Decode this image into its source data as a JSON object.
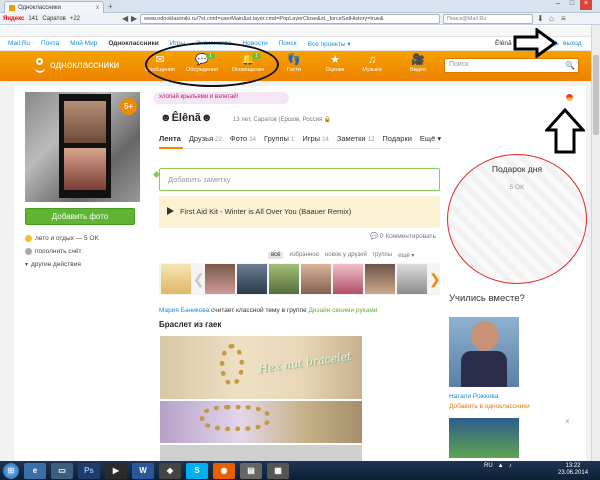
{
  "browser": {
    "tab_title": "Одноклассники",
    "tab_close": "x",
    "new_tab": "+",
    "window_buttons": [
      "–",
      "□",
      "×"
    ],
    "toolbar_items": [
      "Яндекс",
      "141",
      "Саратов",
      "+22"
    ],
    "url": "www.odnoklassniki.ru/?st.cmd=userMain&st.layer.cmd=PopLayerClose&st._forceSetHistory=true&",
    "search_placeholder": "Поиск@Mail.Ru"
  },
  "mailru_bar": {
    "items": [
      "Mail.Ru",
      "Почта",
      "Мой Мир",
      "Одноклассники",
      "Игры",
      "Знакомства",
      "Новости",
      "Поиск",
      "Все проекты ▾"
    ],
    "active": "Одноклассники",
    "user": "Êlênã",
    "help": "помощь",
    "exit": "выход"
  },
  "ok_toolbar": {
    "logo_text": "одноклассники",
    "nav": [
      {
        "label": "Сообщения",
        "icon": "envelope-icon",
        "badge": ""
      },
      {
        "label": "Обсуждения",
        "icon": "discussions-icon",
        "badge": "1"
      },
      {
        "label": "Оповещения",
        "icon": "bell-icon",
        "badge": "1"
      },
      {
        "label": "Гости",
        "icon": "footprints-icon",
        "badge": ""
      },
      {
        "label": "Оценки",
        "icon": "rating-icon",
        "badge": ""
      },
      {
        "label": "Музыка",
        "icon": "music-icon",
        "badge": ""
      },
      {
        "label": "Видео",
        "icon": "video-icon",
        "badge": ""
      }
    ],
    "search_placeholder": "Поиск"
  },
  "profile": {
    "promo": "хлопай крыльями и взлетай!",
    "name": "☻Êlênã☻",
    "info": "13 лет, Саратов (Ершов, Россия",
    "five_badge": "5+",
    "add_photo": "Добавить фото",
    "links": [
      {
        "text": "лето и отдых — 5 OK",
        "dot": "#f0c030"
      },
      {
        "text": "пополнить счёт",
        "dot": "#aaaaaa"
      },
      {
        "text": "другие действия",
        "dot": ""
      }
    ]
  },
  "tabs": [
    {
      "label": "Лента",
      "count": ""
    },
    {
      "label": "Друзья",
      "count": "22"
    },
    {
      "label": "Фото",
      "count": "34"
    },
    {
      "label": "Группы",
      "count": "1"
    },
    {
      "label": "Игры",
      "count": "14"
    },
    {
      "label": "Заметки",
      "count": "12"
    },
    {
      "label": "Подарки",
      "count": ""
    },
    {
      "label": "Ещё ▾",
      "count": ""
    }
  ],
  "feed": {
    "note_placeholder": "Добавить заметку",
    "music_track": "First Aid Kit - Winter is All Over You (Baauer Remix)",
    "comments": "0 Комментировать",
    "friend_filters": [
      "всё",
      "избранное",
      "новое у друзей",
      "группы",
      "ещё ▾"
    ],
    "post_user": "Мария Баникова",
    "post_action": "считает классной тему в группе",
    "post_group": "Дизайн своими руками",
    "post_title": "Браслет из гаек",
    "image_text": "Hex nut bracelet"
  },
  "sidebar": {
    "gift_title": "Подарок дня",
    "gift_price": "5 OK",
    "study_title": "Учились вместе?",
    "person_name": "Натали Рожкова",
    "add_friend": "Добавить в одноклассники",
    "close": "×"
  },
  "taskbar": {
    "apps": [
      "Ps",
      "W"
    ],
    "lang": "RU",
    "time": "13:22",
    "date": "23.06.2014"
  }
}
